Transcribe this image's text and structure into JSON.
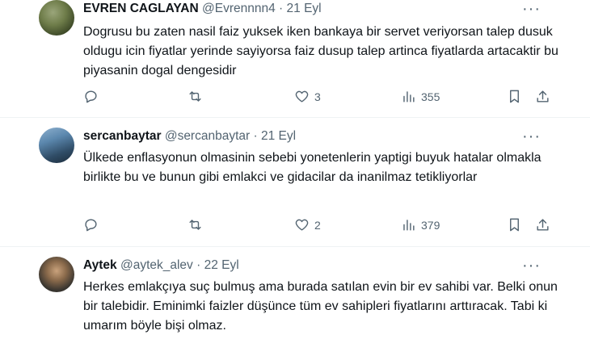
{
  "tweets": [
    {
      "name": "EVREN CAGLAYAN",
      "handle": "@Evrennnn4",
      "separator": "·",
      "time": "21 Eyl",
      "text": "Dogrusu bu zaten nasil faiz yuksek iken bankaya bir servet veriyorsan talep dusuk oldugu icin fiyatlar yerinde sayiyorsa faiz dusup talep artinca fiyatlarda artacaktir bu piyasanin dogal dengesidir",
      "likes": "3",
      "views": "355"
    },
    {
      "name": "sercanbaytar",
      "handle": "@sercanbaytar",
      "separator": "·",
      "time": "21 Eyl",
      "text": "Ülkede enflasyonun olmasinin sebebi yonetenlerin yaptigi buyuk hatalar olmakla birlikte bu ve bunun gibi emlakci ve gidacilar da inanilmaz tetikliyorlar",
      "likes": "2",
      "views": "379"
    },
    {
      "name": "Aytek",
      "handle": "@aytek_alev",
      "separator": "·",
      "time": "22 Eyl",
      "text": "Herkes emlakçıya suç bulmuş ama burada satılan evin bir ev sahibi var. Belki onun bir talebidir. Eminimki faizler düşünce tüm ev sahipleri fiyatlarını arttıracak. Tabi ki umarım böyle bişi olmaz."
    }
  ],
  "icons": {
    "more": "more-horizontal-icon",
    "reply": "reply-icon",
    "retweet": "retweet-icon",
    "like": "heart-icon",
    "views": "views-icon",
    "bookmark": "bookmark-icon",
    "share": "share-icon"
  },
  "colors": {
    "text": "#0f1419",
    "secondary": "#536471",
    "divider": "#eff3f4"
  }
}
